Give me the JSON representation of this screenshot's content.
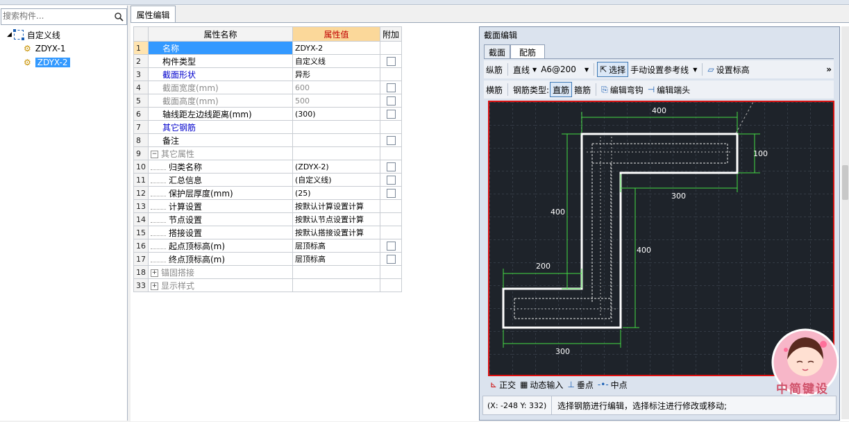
{
  "search": {
    "placeholder": "搜索构件..."
  },
  "tree": {
    "root": "自定义线",
    "children": [
      "ZDYX-1",
      "ZDYX-2"
    ],
    "selected": "ZDYX-2"
  },
  "tabs": {
    "property_edit": "属性编辑"
  },
  "grid": {
    "headers": {
      "name": "属性名称",
      "value": "属性值",
      "add": "附加"
    },
    "rows": [
      {
        "no": "1",
        "name": "名称",
        "value": "ZDYX-2",
        "checkbox": false,
        "style": "selected"
      },
      {
        "no": "2",
        "name": "构件类型",
        "value": "自定义线",
        "checkbox": true,
        "style": "normal"
      },
      {
        "no": "3",
        "name": "截面形状",
        "value": "异形",
        "checkbox": false,
        "style": "blue"
      },
      {
        "no": "4",
        "name": "截面宽度(mm)",
        "value": "600",
        "checkbox": true,
        "style": "gray"
      },
      {
        "no": "5",
        "name": "截面高度(mm)",
        "value": "500",
        "checkbox": true,
        "style": "gray"
      },
      {
        "no": "6",
        "name": "轴线距左边线距离(mm)",
        "value": "(300)",
        "checkbox": true,
        "style": "normal"
      },
      {
        "no": "7",
        "name": "其它钢筋",
        "value": "",
        "checkbox": false,
        "style": "blue"
      },
      {
        "no": "8",
        "name": "备注",
        "value": "",
        "checkbox": true,
        "style": "normal"
      },
      {
        "no": "9",
        "name": "其它属性",
        "value": "",
        "checkbox": false,
        "style": "group-open"
      },
      {
        "no": "10",
        "name": "归类名称",
        "value": "(ZDYX-2)",
        "checkbox": true,
        "style": "child"
      },
      {
        "no": "11",
        "name": "汇总信息",
        "value": "(自定义线)",
        "checkbox": true,
        "style": "child"
      },
      {
        "no": "12",
        "name": "保护层厚度(mm)",
        "value": "(25)",
        "checkbox": true,
        "style": "child"
      },
      {
        "no": "13",
        "name": "计算设置",
        "value": "按默认计算设置计算",
        "checkbox": false,
        "style": "child"
      },
      {
        "no": "14",
        "name": "节点设置",
        "value": "按默认节点设置计算",
        "checkbox": false,
        "style": "child"
      },
      {
        "no": "15",
        "name": "搭接设置",
        "value": "按默认搭接设置计算",
        "checkbox": false,
        "style": "child"
      },
      {
        "no": "16",
        "name": "起点顶标高(m)",
        "value": "层顶标高",
        "checkbox": true,
        "style": "child"
      },
      {
        "no": "17",
        "name": "终点顶标高(m)",
        "value": "层顶标高",
        "checkbox": true,
        "style": "child"
      },
      {
        "no": "18",
        "name": "锚固搭接",
        "value": "",
        "checkbox": false,
        "style": "group-closed"
      },
      {
        "no": "33",
        "name": "显示样式",
        "value": "",
        "checkbox": false,
        "style": "group-closed"
      }
    ]
  },
  "section_editor": {
    "title": "截面编辑",
    "tabs": [
      "截面",
      "配筋"
    ],
    "active_tab": "配筋",
    "toolbar1": {
      "rebar_kind": "纵筋",
      "line_mode": "直线",
      "spec": "A6@200",
      "select": "选择",
      "ref_line": "手动设置参考线",
      "set_elev": "设置标高",
      "more": "»"
    },
    "toolbar2": {
      "stirrup": "横筋",
      "type_label": "钢筋类型:",
      "straight": "直筋",
      "hoop": "箍筋",
      "edit_hook": "编辑弯钩",
      "edit_end": "编辑端头"
    },
    "dimensions": {
      "top": "400",
      "right": "100",
      "mid_h": "300",
      "left_v": "400",
      "right_v": "400",
      "left_h": "200",
      "bottom": "300"
    },
    "status_tools": {
      "ortho": "正交",
      "dyn_input": "动态输入",
      "perp": "垂点",
      "mid": "中点"
    },
    "status": {
      "coords": "(X: -248 Y: 332)",
      "hint": "选择钢筋进行编辑，选择标注进行修改或移动;"
    }
  },
  "colors": {
    "selection": "#3399ff",
    "header_value": "#fbd89a",
    "canvas_bg": "#1e232a",
    "canvas_border": "#dd1111",
    "dim_line": "#44dd44"
  },
  "badge": {
    "text": "中简键设"
  }
}
